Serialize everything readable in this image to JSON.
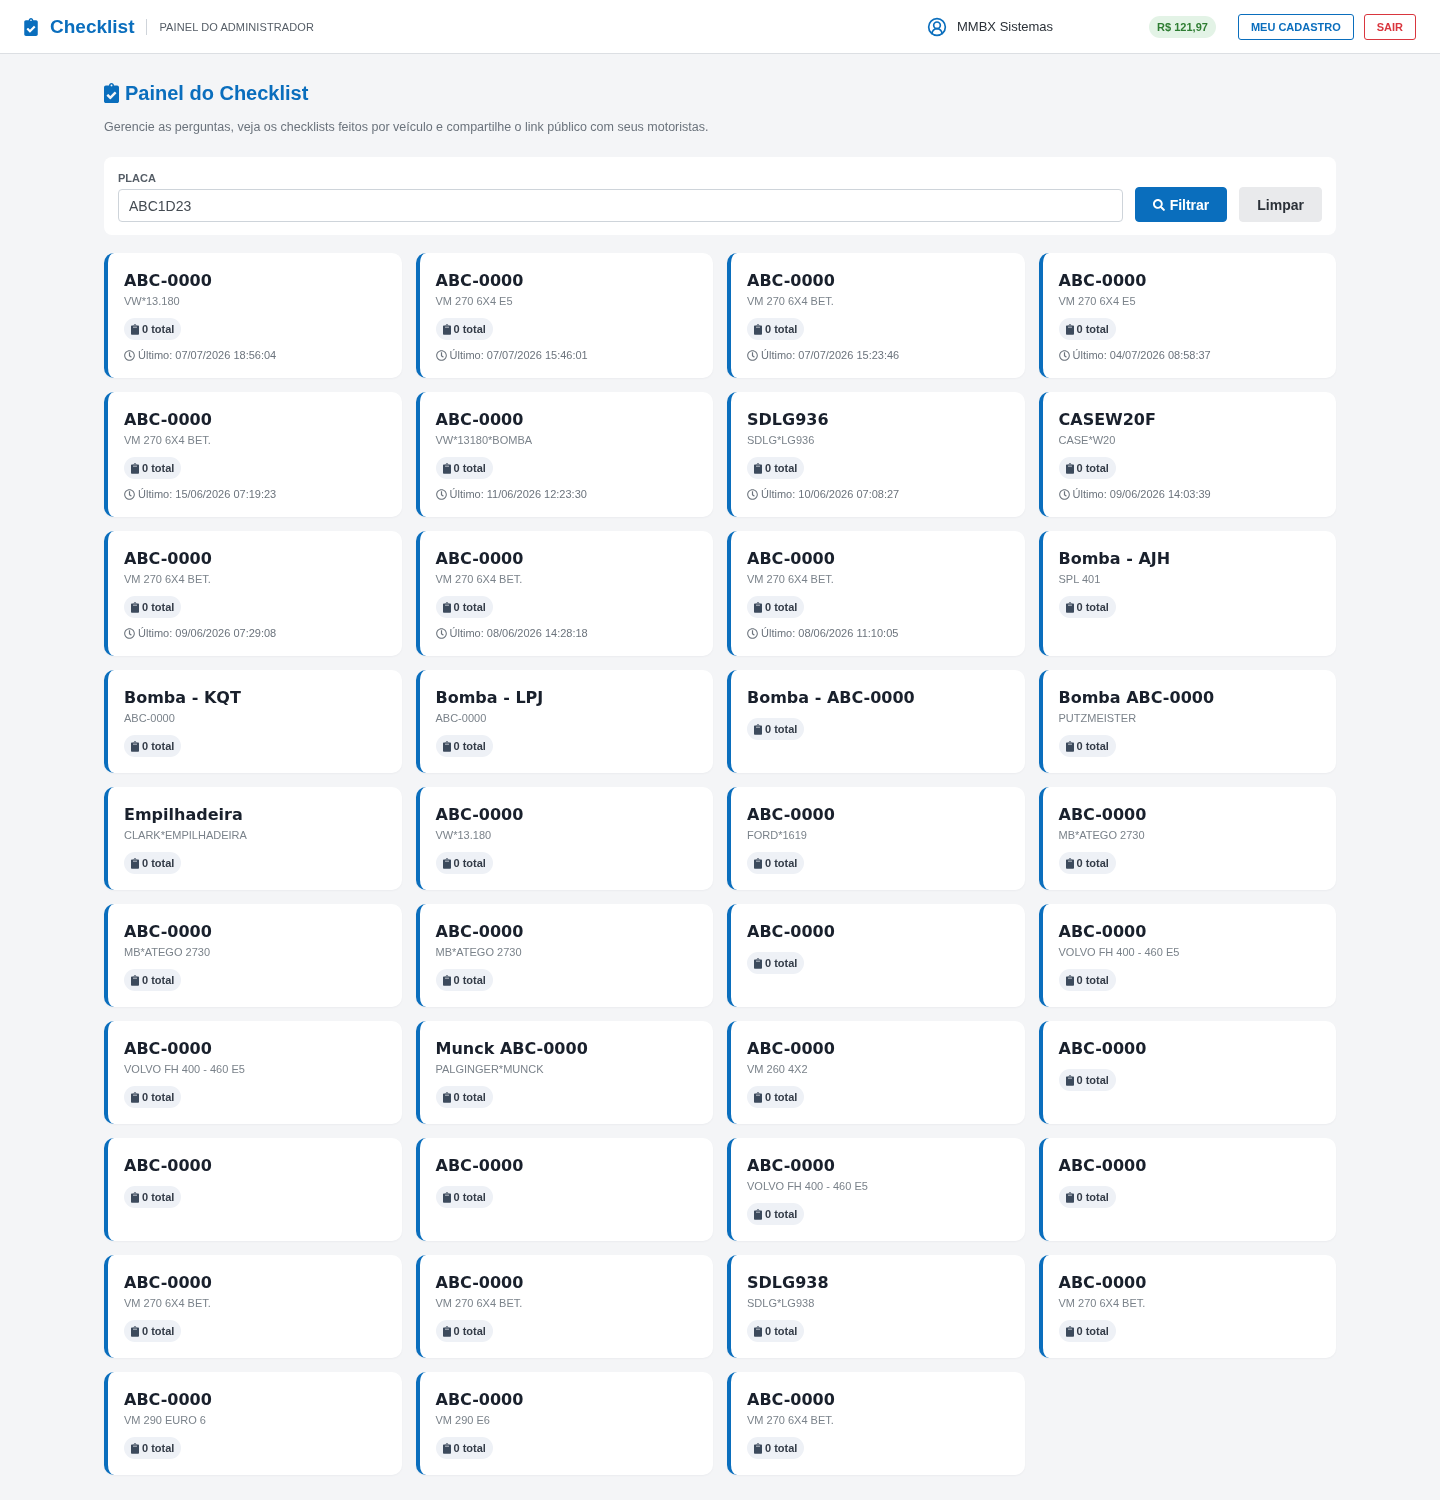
{
  "header": {
    "brand": "Checklist",
    "section": "PAINEL DO ADMINISTRADOR",
    "user": "MMBX Sistemas",
    "balance": "R$ 121,97",
    "buttons": [
      {
        "label": "MEU CADASTRO",
        "kind": "primary"
      },
      {
        "label": "SAIR",
        "kind": "danger"
      }
    ]
  },
  "page": {
    "title": "Painel do Checklist",
    "description": "Gerencie as perguntas, veja os checklists feitos por veículo e compartilhe o link público com seus motoristas."
  },
  "filter": {
    "label": "PLACA",
    "value": "ABC1D23",
    "buttons": [
      {
        "label": "Filtrar",
        "kind": "primary"
      },
      {
        "label": "Limpar",
        "kind": "secondary"
      }
    ]
  },
  "vehicles": [
    {
      "plate": "ABC-0000",
      "model": "VW*13.180",
      "count": "0 total",
      "last": "Último: 07/07/2026 18:56:04"
    },
    {
      "plate": "ABC-0000",
      "model": "VM 270 6X4 E5",
      "count": "0 total",
      "last": "Último: 07/07/2026 15:46:01"
    },
    {
      "plate": "ABC-0000",
      "model": "VM 270 6X4 BET.",
      "count": "0 total",
      "last": "Último: 07/07/2026 15:23:46"
    },
    {
      "plate": "ABC-0000",
      "model": "VM 270 6X4 E5",
      "count": "0 total",
      "last": "Último: 04/07/2026 08:58:37"
    },
    {
      "plate": "ABC-0000",
      "model": "VM 270 6X4 BET.",
      "count": "0 total",
      "last": "Último: 15/06/2026 07:19:23"
    },
    {
      "plate": "ABC-0000",
      "model": "VW*13180*BOMBA",
      "count": "0 total",
      "last": "Último: 11/06/2026 12:23:30"
    },
    {
      "plate": "SDLG936",
      "model": "SDLG*LG936",
      "count": "0 total",
      "last": "Último: 10/06/2026 07:08:27"
    },
    {
      "plate": "CASEW20F",
      "model": "CASE*W20",
      "count": "0 total",
      "last": "Último: 09/06/2026 14:03:39"
    },
    {
      "plate": "ABC-0000",
      "model": "VM 270 6X4 BET.",
      "count": "0 total",
      "last": "Último: 09/06/2026 07:29:08"
    },
    {
      "plate": "ABC-0000",
      "model": "VM 270 6X4 BET.",
      "count": "0 total",
      "last": "Último: 08/06/2026 14:28:18"
    },
    {
      "plate": "ABC-0000",
      "model": "VM 270 6X4 BET.",
      "count": "0 total",
      "last": "Último: 08/06/2026 11:10:05"
    },
    {
      "plate": "Bomba - AJH",
      "model": "SPL 401",
      "count": "0 total"
    },
    {
      "plate": "Bomba - KQT",
      "model": "ABC-0000",
      "count": "0 total"
    },
    {
      "plate": "Bomba - LPJ",
      "model": "ABC-0000",
      "count": "0 total"
    },
    {
      "plate": "Bomba - ABC-0000",
      "count": "0 total"
    },
    {
      "plate": "Bomba ABC-0000",
      "model": "PUTZMEISTER",
      "count": "0 total"
    },
    {
      "plate": "Empilhadeira",
      "model": "CLARK*EMPILHADEIRA",
      "count": "0 total"
    },
    {
      "plate": "ABC-0000",
      "model": "VW*13.180",
      "count": "0 total"
    },
    {
      "plate": "ABC-0000",
      "model": "FORD*1619",
      "count": "0 total"
    },
    {
      "plate": "ABC-0000",
      "model": "MB*ATEGO 2730",
      "count": "0 total"
    },
    {
      "plate": "ABC-0000",
      "model": "MB*ATEGO 2730",
      "count": "0 total"
    },
    {
      "plate": "ABC-0000",
      "model": "MB*ATEGO 2730",
      "count": "0 total"
    },
    {
      "plate": "ABC-0000",
      "count": "0 total"
    },
    {
      "plate": "ABC-0000",
      "model": "VOLVO FH 400 - 460 E5",
      "count": "0 total"
    },
    {
      "plate": "ABC-0000",
      "model": "VOLVO FH 400 - 460 E5",
      "count": "0 total"
    },
    {
      "plate": "Munck ABC-0000",
      "model": "PALGINGER*MUNCK",
      "count": "0 total"
    },
    {
      "plate": "ABC-0000",
      "model": "VM 260 4X2",
      "count": "0 total"
    },
    {
      "plate": "ABC-0000",
      "count": "0 total"
    },
    {
      "plate": "ABC-0000",
      "count": "0 total"
    },
    {
      "plate": "ABC-0000",
      "count": "0 total"
    },
    {
      "plate": "ABC-0000",
      "model": "VOLVO FH 400 - 460 E5",
      "count": "0 total"
    },
    {
      "plate": "ABC-0000",
      "count": "0 total"
    },
    {
      "plate": "ABC-0000",
      "model": "VM 270 6X4 BET.",
      "count": "0 total"
    },
    {
      "plate": "ABC-0000",
      "model": "VM 270 6X4 BET.",
      "count": "0 total"
    },
    {
      "plate": "SDLG938",
      "model": "SDLG*LG938",
      "count": "0 total"
    },
    {
      "plate": "ABC-0000",
      "model": "VM 270 6X4 BET.",
      "count": "0 total"
    },
    {
      "plate": "ABC-0000",
      "model": "VM 290 EURO 6",
      "count": "0 total"
    },
    {
      "plate": "ABC-0000",
      "model": "VM 290 E6",
      "count": "0 total"
    },
    {
      "plate": "ABC-0000",
      "model": "VM 270 6X4 BET.",
      "count": "0 total"
    }
  ]
}
